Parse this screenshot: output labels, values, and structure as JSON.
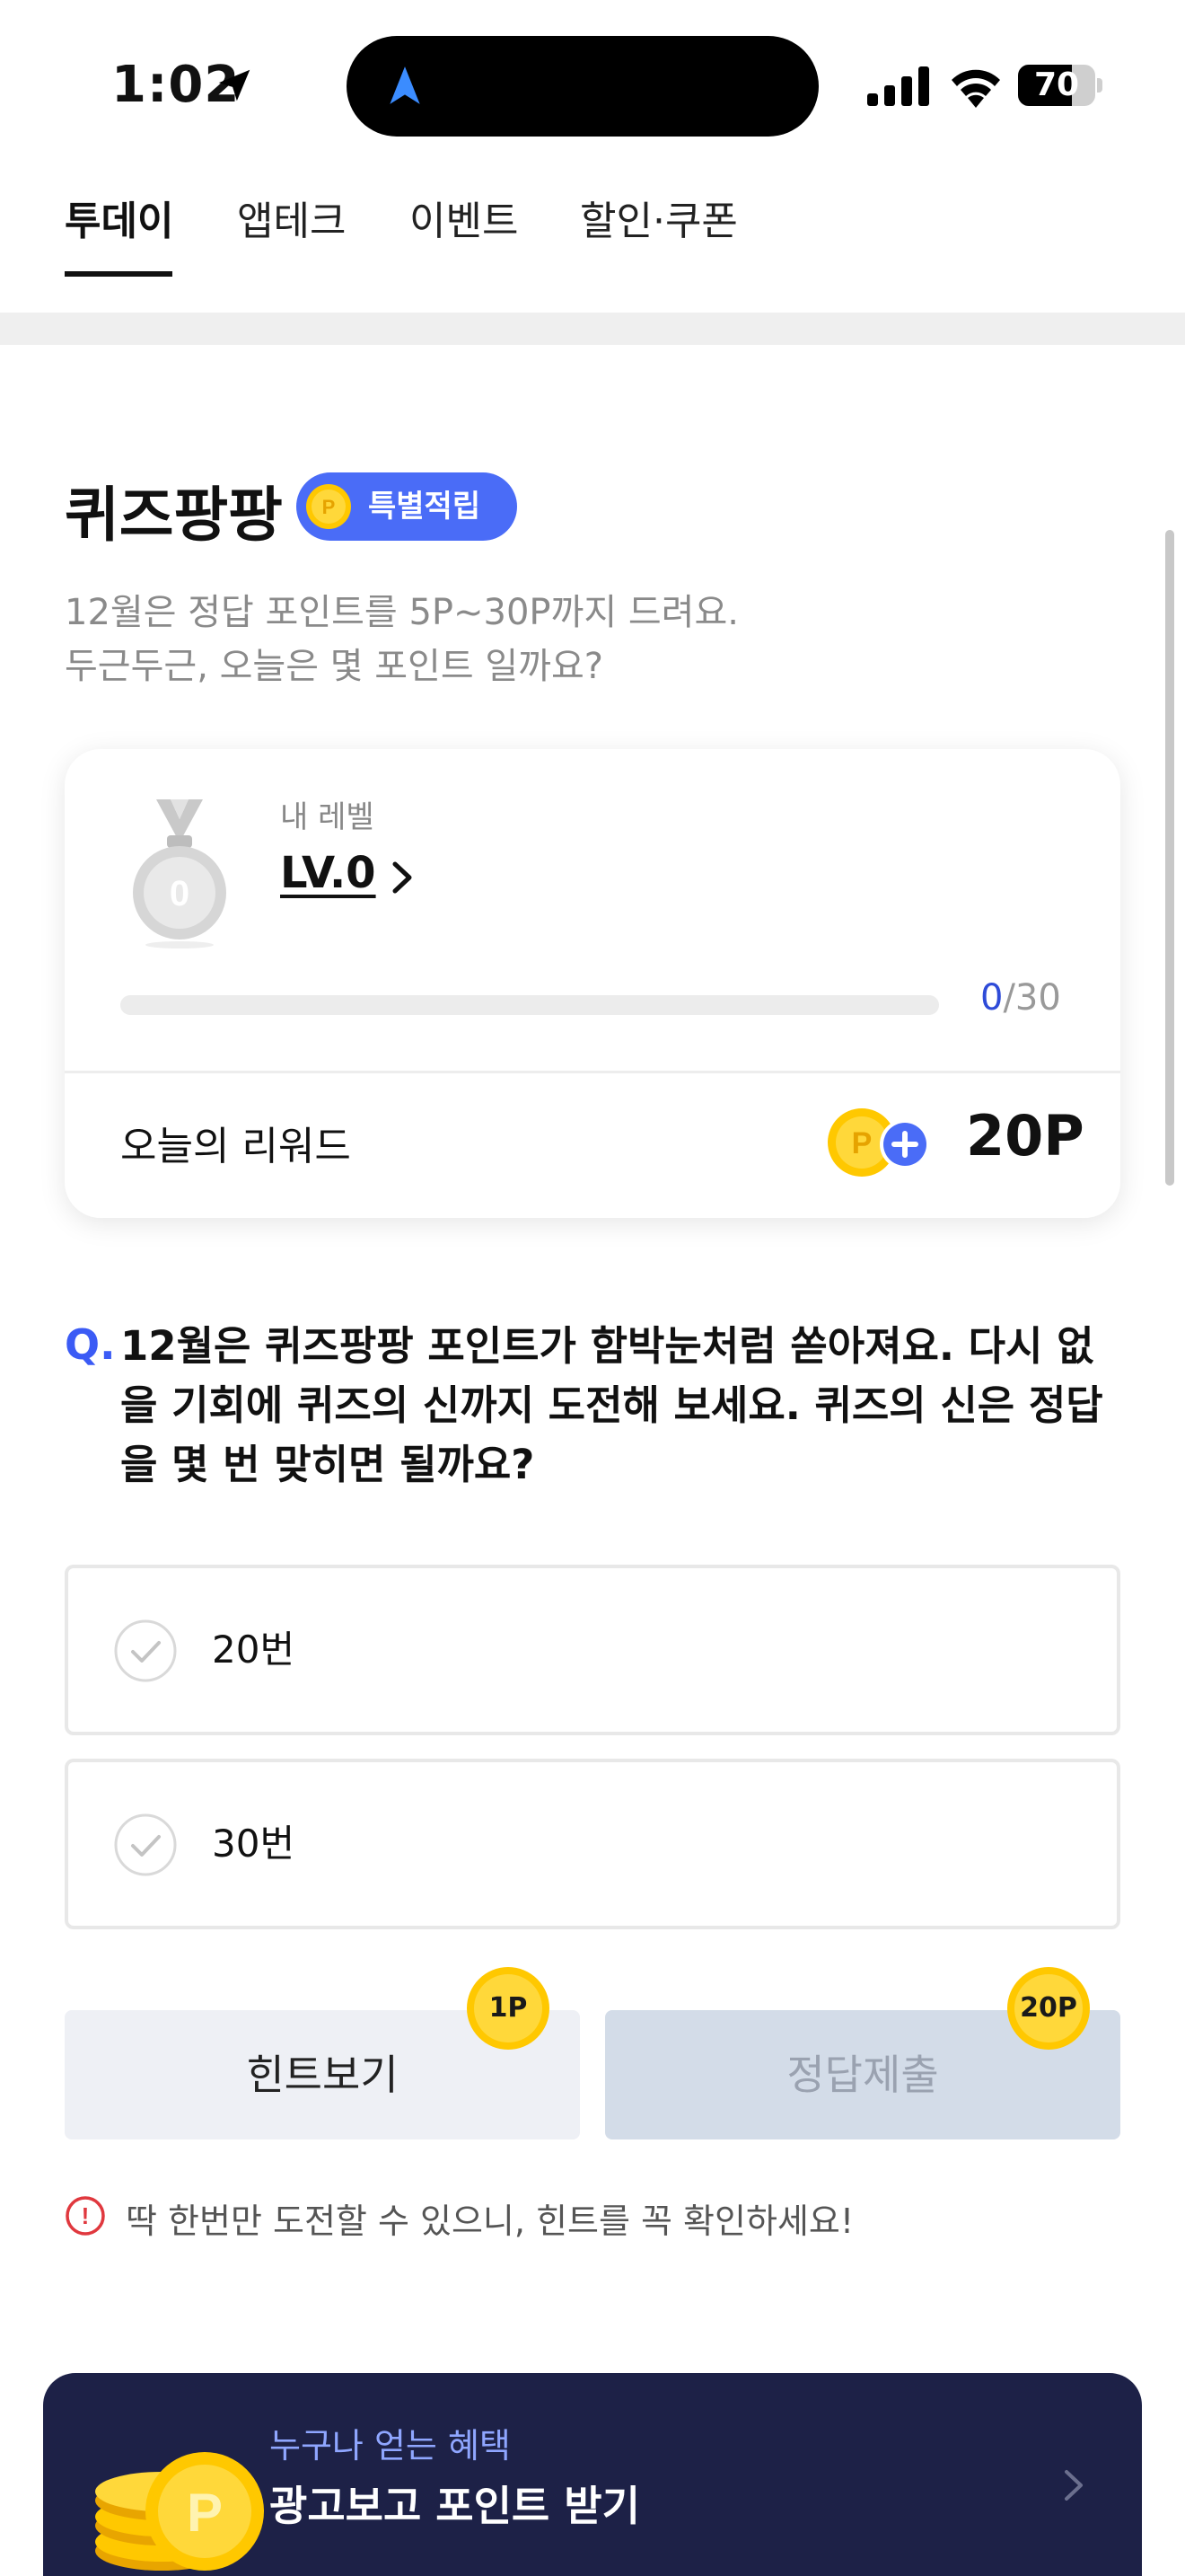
{
  "status_bar": {
    "time": "1:02",
    "battery_level": "70",
    "battery_fraction": 0.7
  },
  "tabs": [
    {
      "label": "투데이",
      "active": true
    },
    {
      "label": "앱테크",
      "active": false
    },
    {
      "label": "이벤트",
      "active": false
    },
    {
      "label": "할인·쿠폰",
      "active": false
    }
  ],
  "header": {
    "title": "퀴즈팡팡",
    "badge_label": "특별적립",
    "badge_icon": "P",
    "description_line1": "12월은 정답 포인트를 5P~30P까지 드려요.",
    "description_line2": "두근두근, 오늘은 몇 포인트 일까요?"
  },
  "level_card": {
    "caption": "내 레벨",
    "level": "LV.0",
    "medal_number": "0",
    "progress_current": "0",
    "progress_total": "/30",
    "progress_fraction": 0,
    "reward_label": "오늘의 리워드",
    "reward_value": "20P"
  },
  "question": {
    "mark": "Q.",
    "text": "12월은 퀴즈팡팡 포인트가 함박눈처럼 쏟아져요. 다시 없을 기회에 퀴즈의 신까지 도전해 보세요. 퀴즈의 신은 정답을 몇 번 맞히면 될까요?"
  },
  "options": [
    {
      "label": "20번"
    },
    {
      "label": "30번"
    }
  ],
  "buttons": {
    "hint_label": "힌트보기",
    "hint_points": "1P",
    "submit_label": "정답제출",
    "submit_points": "20P"
  },
  "warning": {
    "icon": "!",
    "text": "딱 한번만 도전할 수 있으니, 힌트를 꼭 확인하세요!"
  },
  "banner": {
    "subtitle": "누구나 얻는 혜택",
    "title": "광고보고 포인트 받기",
    "coin_glyph": "P"
  },
  "colors": {
    "accent": "#4a6cf7",
    "banner_bg": "#1d2147",
    "coin": "#ffc800"
  }
}
